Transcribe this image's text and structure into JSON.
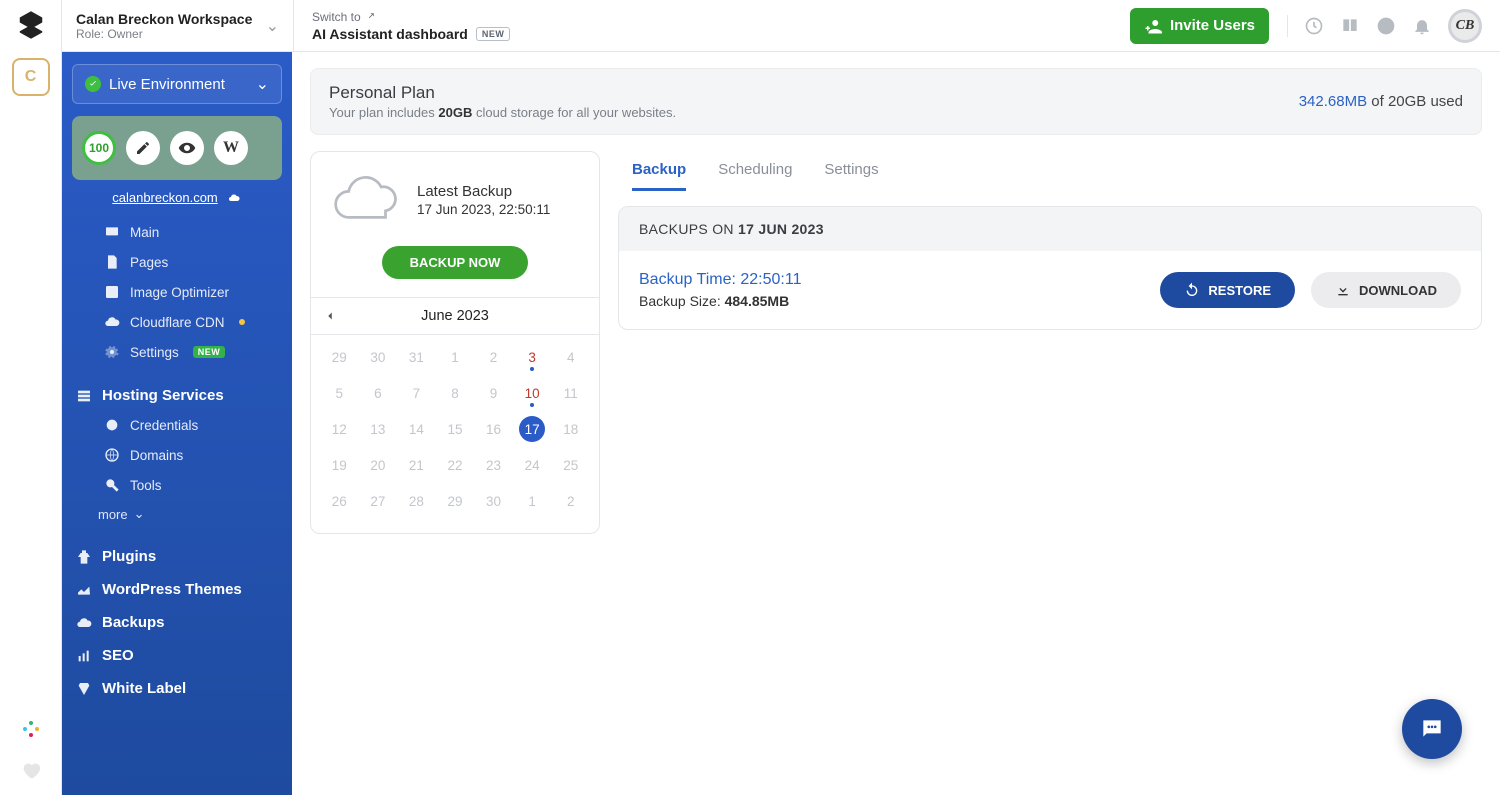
{
  "workspace": {
    "name": "Calan Breckon Workspace",
    "role": "Role: Owner",
    "badge_letter": "C",
    "avatar_initials": "CB"
  },
  "header": {
    "switch_to": "Switch to",
    "ai_dashboard": "AI Assistant dashboard",
    "new_tag": "NEW",
    "invite": "Invite Users"
  },
  "sidebar": {
    "env_label": "Live Environment",
    "score": "100",
    "site_link": "calanbreckon.com",
    "group_site": {
      "items": [
        "Main",
        "Pages",
        "Image Optimizer",
        "Cloudflare CDN",
        "Settings"
      ]
    },
    "hosting_title": "Hosting Services",
    "hosting_items": [
      "Credentials",
      "Domains",
      "Tools"
    ],
    "more": "more",
    "other_sections": [
      "Plugins",
      "WordPress Themes",
      "Backups",
      "SEO",
      "White Label"
    ],
    "settings_new": "NEW"
  },
  "plan": {
    "title": "Personal Plan",
    "desc_prefix": "Your plan includes ",
    "desc_bold": "20GB",
    "desc_suffix": " cloud storage for all your websites.",
    "used": "342.68MB",
    "of_total": " of 20GB used"
  },
  "backup_card": {
    "latest_label": "Latest Backup",
    "latest_time": "17 Jun 2023, 22:50:11",
    "backup_now": "BACKUP NOW",
    "calendar_title": "June 2023",
    "calendar": [
      {
        "d": "29",
        "out": true
      },
      {
        "d": "30",
        "out": true
      },
      {
        "d": "31",
        "out": true
      },
      {
        "d": "1"
      },
      {
        "d": "2"
      },
      {
        "d": "3",
        "marked": true
      },
      {
        "d": "4"
      },
      {
        "d": "5"
      },
      {
        "d": "6"
      },
      {
        "d": "7"
      },
      {
        "d": "8"
      },
      {
        "d": "9"
      },
      {
        "d": "10",
        "marked": true
      },
      {
        "d": "11"
      },
      {
        "d": "12"
      },
      {
        "d": "13"
      },
      {
        "d": "14"
      },
      {
        "d": "15"
      },
      {
        "d": "16"
      },
      {
        "d": "17",
        "selected": true
      },
      {
        "d": "18"
      },
      {
        "d": "19"
      },
      {
        "d": "20"
      },
      {
        "d": "21"
      },
      {
        "d": "22"
      },
      {
        "d": "23"
      },
      {
        "d": "24"
      },
      {
        "d": "25"
      },
      {
        "d": "26"
      },
      {
        "d": "27"
      },
      {
        "d": "28"
      },
      {
        "d": "29"
      },
      {
        "d": "30"
      },
      {
        "d": "1",
        "out": true
      },
      {
        "d": "2",
        "out": true
      }
    ]
  },
  "tabs": [
    "Backup",
    "Scheduling",
    "Settings"
  ],
  "panel": {
    "head_prefix": "BACKUPS ON ",
    "head_date": "17 JUN 2023",
    "backup_time_label": "Backup Time: ",
    "backup_time": "22:50:11",
    "backup_size_label": "Backup Size: ",
    "backup_size": "484.85MB",
    "restore": "RESTORE",
    "download": "DOWNLOAD"
  }
}
